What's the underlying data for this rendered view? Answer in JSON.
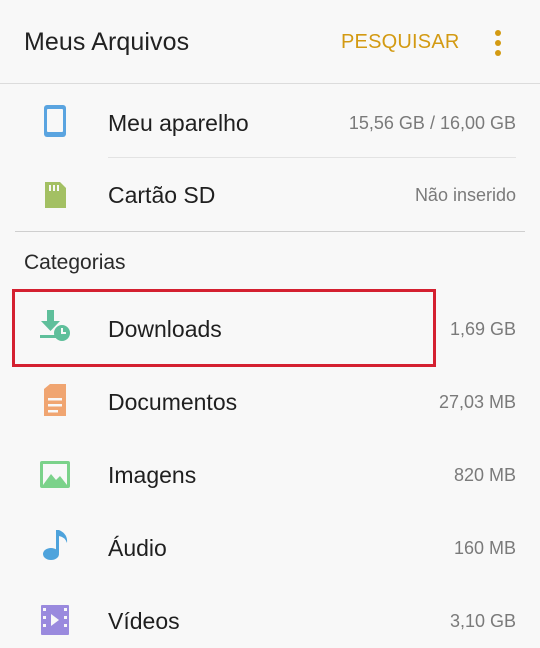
{
  "header": {
    "title": "Meus Arquivos",
    "search_label": "PESQUISAR",
    "more_icon": "more-vertical-icon"
  },
  "storage": [
    {
      "label": "Meu aparelho",
      "value": "15,56 GB / 16,00 GB",
      "icon": "phone-icon",
      "color": "#5aa4e0"
    },
    {
      "label": "Cartão SD",
      "value": "Não inserido",
      "icon": "sd-card-icon",
      "color": "#a3c063"
    }
  ],
  "categories": {
    "title": "Categorias",
    "items": [
      {
        "label": "Downloads",
        "value": "1,69 GB",
        "icon": "download-icon",
        "color": "#5fbf9b"
      },
      {
        "label": "Documentos",
        "value": "27,03 MB",
        "icon": "document-icon",
        "color": "#f0a571"
      },
      {
        "label": "Imagens",
        "value": "820 MB",
        "icon": "image-icon",
        "color": "#7bd28a"
      },
      {
        "label": "Áudio",
        "value": "160 MB",
        "icon": "music-note-icon",
        "color": "#4ea3dc"
      },
      {
        "label": "Vídeos",
        "value": "3,10 GB",
        "icon": "video-icon",
        "color": "#9a8ade"
      }
    ]
  },
  "colors": {
    "accent": "#d39a12",
    "highlight": "#d42030"
  }
}
